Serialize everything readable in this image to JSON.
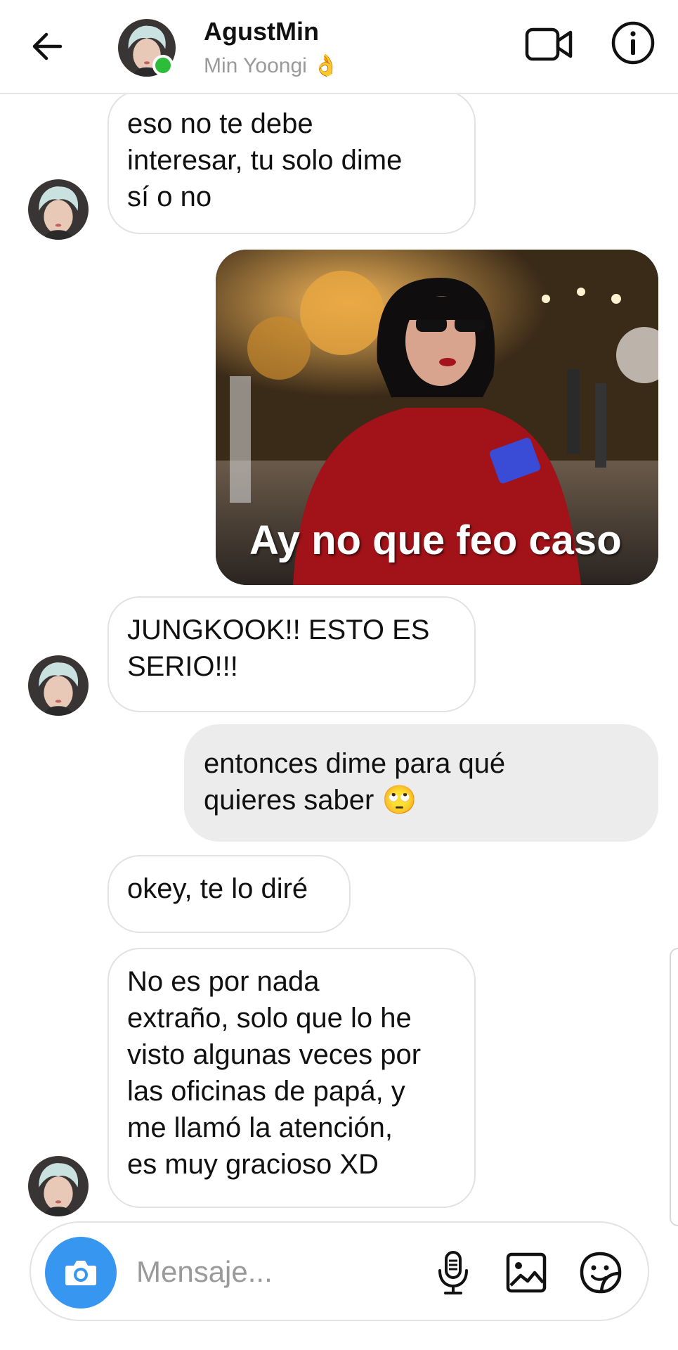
{
  "header": {
    "title": "AgustMin",
    "subtitle": "Min Yoongi 👌",
    "online_color": "#2dbd3a",
    "icons": [
      "back-arrow-icon",
      "video-camera-icon",
      "info-icon"
    ]
  },
  "messages": [
    {
      "direction": "received",
      "type": "text",
      "text": "eso no te debe\ninteresar, tu solo dime\nsí o no"
    },
    {
      "direction": "sent",
      "type": "image",
      "caption": "Ay no que feo caso"
    },
    {
      "direction": "received",
      "type": "text",
      "text": "JUNGKOOK!! ESTO ES\nSERIO!!!"
    },
    {
      "direction": "sent",
      "type": "text",
      "text": "entonces dime para qué\nquieres saber 🙄"
    },
    {
      "direction": "received",
      "type": "text",
      "text": "okey, te lo diré"
    },
    {
      "direction": "received",
      "type": "text",
      "text": "No es por nada\nextraño, solo que lo he\nvisto algunas veces por\nlas oficinas de papá, y\nme llamó la atención,\nes muy gracioso XD"
    }
  ],
  "composer": {
    "placeholder": "Mensaje...",
    "camera_color": "#3797f0",
    "icons": [
      "camera-icon",
      "microphone-icon",
      "gallery-icon",
      "sticker-icon"
    ]
  }
}
